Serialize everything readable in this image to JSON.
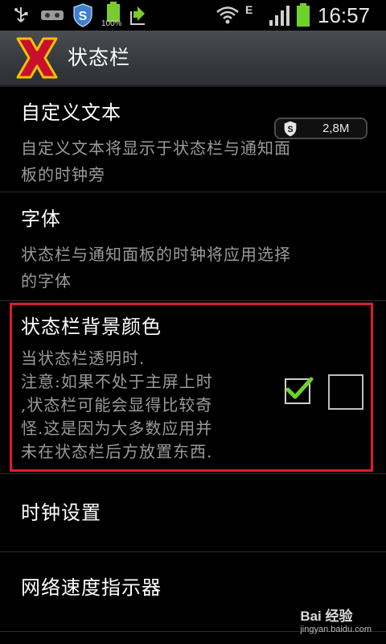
{
  "status_bar": {
    "time": "16:57",
    "battery_percent_label": "100%",
    "network_type": "E",
    "icons": [
      "usb-icon",
      "voicemail-icon",
      "security-s-icon",
      "battery-full-icon",
      "download-icon",
      "wifi-icon",
      "signal-bars-icon",
      "battery-icon"
    ]
  },
  "title_bar": {
    "title": "状态栏",
    "icon": "x-app-icon",
    "icon_colors": {
      "primary": "#c8102e",
      "outline": "#f2c200"
    }
  },
  "overlay": {
    "value": "2,8M",
    "icon": "security-s-icon"
  },
  "items": [
    {
      "title": "自定义文本",
      "summary_lines": [
        "自定义文本将显示于状态栏与通知面",
        "板的时钟旁"
      ]
    },
    {
      "title": "字体",
      "summary_lines": [
        "状态栏与通知面板的时钟将应用选择",
        "的字体"
      ]
    },
    {
      "title": "状态栏背景颜色",
      "summary_lines": [
        "当状态栏透明时.",
        "注意:如果不处于主屏上时",
        ",状态栏可能会显得比较奇",
        "怪.这是因为大多数应用并",
        "未在状态栏后方放置东西."
      ],
      "checkbox_checked": true,
      "highlighted": true
    },
    {
      "title": "时钟设置"
    },
    {
      "title": "网络速度指示器"
    }
  ],
  "colors": {
    "background": "#000000",
    "title_bar": "#3a3d42",
    "summary_text": "#9a9a9a",
    "highlight": "#e01b2b",
    "check_mark": "#6fd12b"
  },
  "watermark": {
    "logo": "Bai 经验",
    "url": "jingyan.baidu.com"
  }
}
